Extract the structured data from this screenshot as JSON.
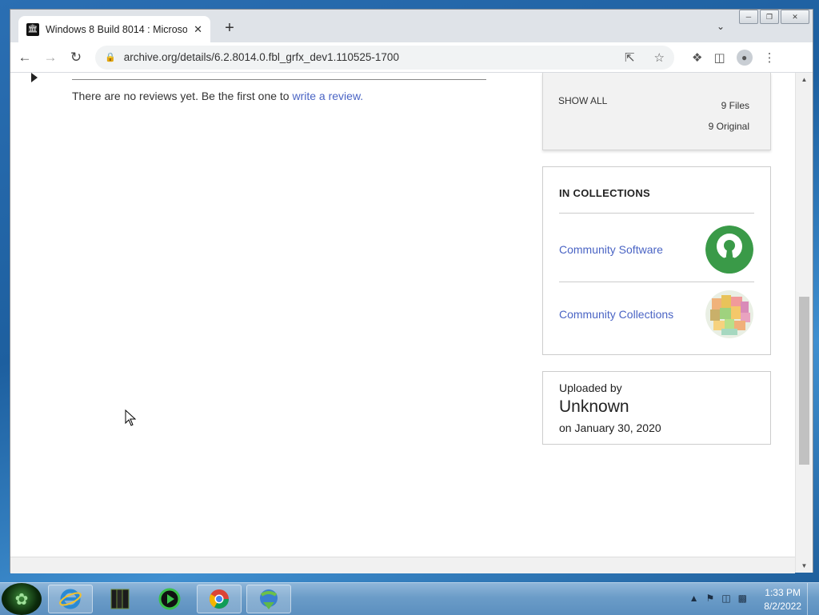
{
  "browser": {
    "tab_title": "Windows 8 Build 8014 : Microsof",
    "tab_favicon": "archive-icon",
    "url": "archive.org/details/6.2.8014.0.fbl_grfx_dev1.110525-1700"
  },
  "reviews": {
    "empty_text": "There are no reviews yet. Be the first one to",
    "link_text": "write a review."
  },
  "files": {
    "show_all": "SHOW ALL",
    "files_count": "9 Files",
    "original_count": "9 Original"
  },
  "collections": {
    "heading": "IN COLLECTIONS",
    "items": [
      {
        "label": "Community Software",
        "thumb": "open-source-keyhole-icon"
      },
      {
        "label": "Community Collections",
        "thumb": "collage-icon"
      }
    ]
  },
  "uploader": {
    "label": "Uploaded by",
    "name": "Unknown",
    "date": "on January 30, 2020"
  },
  "taskbar": {
    "apps": [
      "internet-explorer-icon",
      "winrar-icon",
      "media-player-icon",
      "chrome-icon",
      "download-manager-icon"
    ],
    "time": "1:33 PM",
    "date": "8/2/2022"
  },
  "colors": {
    "link": "#4a64c4",
    "keyhole_green": "#3a9a48"
  }
}
